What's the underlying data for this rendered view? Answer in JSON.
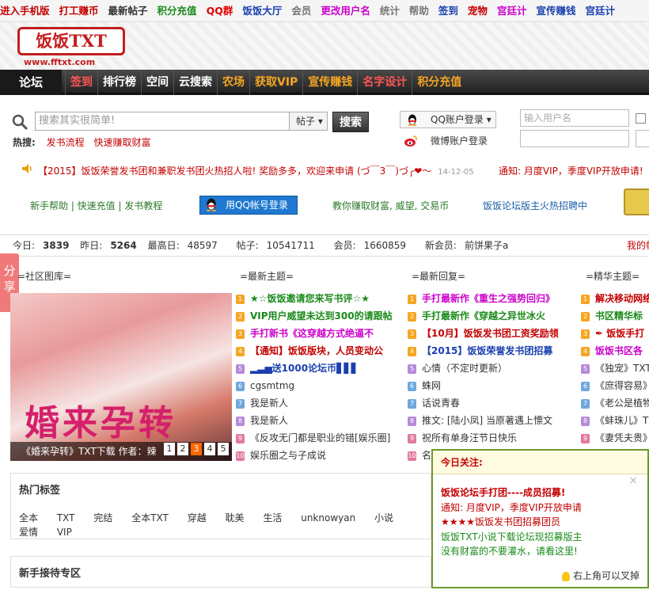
{
  "topbar": [
    {
      "label": "进入手机版",
      "color": "#c40000"
    },
    {
      "label": "打工赚币",
      "color": "#c40000"
    },
    {
      "label": "最新帖子",
      "color": "#333333"
    },
    {
      "label": "积分充值",
      "color": "#1a8a1a"
    },
    {
      "label": "QQ群",
      "color": "#e00000"
    },
    {
      "label": "饭饭大厅",
      "color": "#1a3fb0"
    },
    {
      "label": "会员",
      "color": "#777777"
    },
    {
      "label": "更改用户名",
      "color": "#cc00cc"
    },
    {
      "label": "统计",
      "color": "#777777"
    },
    {
      "label": "帮助",
      "color": "#777777"
    },
    {
      "label": "签到",
      "color": "#1a3fb0"
    },
    {
      "label": "宠物",
      "color": "#c40000"
    },
    {
      "label": "宫廷计",
      "color": "#cc00cc"
    },
    {
      "label": "宣传赚钱",
      "color": "#1a3fb0"
    },
    {
      "label": "宫廷计",
      "color": "#1a3fb0"
    }
  ],
  "logo": {
    "text": "饭饭TXT",
    "url": "www.fftxt.com"
  },
  "nav": {
    "home": "论坛",
    "items": [
      {
        "label": "签到",
        "color": "#ff5555"
      },
      {
        "label": "排行榜",
        "color": "#ffffff"
      },
      {
        "label": "空间",
        "color": "#ffffff"
      },
      {
        "label": "云搜索",
        "color": "#ffffff"
      },
      {
        "label": "农场",
        "color": "#f5a623"
      },
      {
        "label": "获取VIP",
        "color": "#f5a623"
      },
      {
        "label": "宣传赚钱",
        "color": "#f5a623"
      },
      {
        "label": "名字设计",
        "color": "#ff5555"
      },
      {
        "label": "积分充值",
        "color": "#f5a623"
      }
    ]
  },
  "search": {
    "placeholder": "搜索其实很简单!",
    "type": "帖子",
    "button": "搜索"
  },
  "hot": {
    "label": "热搜:",
    "links": [
      "发书流程",
      "快速赚取财富"
    ]
  },
  "login": {
    "qq": "QQ账户登录",
    "weibo": "微博账户登录",
    "username_placeholder": "输入用户名"
  },
  "notice": {
    "text1": "【2015】饭饭荣誉发书团和兼职发书团火热招人啦! 奖励多多，欢迎来申请 (づ￣3￣)づ╭❤～",
    "date": "14-12-05",
    "text2": "通知: 月度VIP，季度VIP开放申请!"
  },
  "quick": {
    "links": "新手帮助 | 快速充值 | 发书教程",
    "qq_button": "用QQ帐号登录",
    "earn": "教你赚取财富, 威望, 交易币",
    "recruit": "饭饭论坛版主火热招聘中"
  },
  "stats": {
    "today_label": "今日:",
    "today": "3839",
    "yesterday_label": "昨日:",
    "yesterday": "5264",
    "max_label": "最高日:",
    "max": "48597",
    "posts_label": "帖子:",
    "posts": "10541711",
    "members_label": "会员:",
    "members": "1660859",
    "newmember_label": "新会员:",
    "newmember": "前饼果子a",
    "right": "我的帖"
  },
  "share": "分享",
  "columns": {
    "gallery": "=社区图库=",
    "latest_topics": "=最新主题=",
    "latest_replies": "=最新回复=",
    "elite_topics": "=精华主题="
  },
  "featured": {
    "title": "婚来孕转",
    "caption": "《婚来孕转》TXT下载  作者：辣",
    "pages": [
      "1",
      "2",
      "3",
      "4",
      "5"
    ],
    "active_page": "3"
  },
  "latest_topics": [
    {
      "n": "1",
      "text": "★☆饭饭邀请您来写书评☆★",
      "color": "#1a8a1a",
      "bold": true
    },
    {
      "n": "2",
      "text": "VIP用户威望未达到300的请跟帖",
      "color": "#1a8a1a",
      "bold": true
    },
    {
      "n": "3",
      "text": "手打新书《这穿越方式绝逼不",
      "color": "#cc00cc",
      "bold": true
    },
    {
      "n": "4",
      "text": "【通知】饭饭版块，人员变动公",
      "color": "#c40000",
      "bold": true
    },
    {
      "n": "5",
      "text": "▂▃▅送1000论坛币▋▋▋",
      "color": "#1a3fb0",
      "bold": true
    },
    {
      "n": "6",
      "text": "cgsmtmg",
      "color": "#333333",
      "bold": false
    },
    {
      "n": "7",
      "text": "我是新人",
      "color": "#333333",
      "bold": false
    },
    {
      "n": "8",
      "text": "我是新人",
      "color": "#333333",
      "bold": false
    },
    {
      "n": "9",
      "text": "《反攻无门都是职业的错[娱乐圈]",
      "color": "#333333",
      "bold": false
    },
    {
      "n": "10",
      "text": "娱乐圈之与子成说",
      "color": "#333333",
      "bold": false
    }
  ],
  "latest_replies": [
    {
      "n": "1",
      "text": "手打最新作《重生之强势回归》",
      "color": "#cc00cc",
      "bold": true
    },
    {
      "n": "2",
      "text": "手打最新作《穿越之异世冰火",
      "color": "#1a8a1a",
      "bold": true
    },
    {
      "n": "3",
      "text": "【10月】饭饭发书团工资奖励领",
      "color": "#c40000",
      "bold": true
    },
    {
      "n": "4",
      "text": "【2015】饭饭荣誉发书团招募",
      "color": "#1a3fb0",
      "bold": true
    },
    {
      "n": "5",
      "text": "心情（不定时更新）",
      "color": "#333333",
      "bold": false
    },
    {
      "n": "6",
      "text": "蛛网",
      "color": "#333333",
      "bold": false
    },
    {
      "n": "7",
      "text": "话说青春",
      "color": "#333333",
      "bold": false
    },
    {
      "n": "8",
      "text": "推文: [陆小凤] 当原著遇上慓文",
      "color": "#333333",
      "bold": false
    },
    {
      "n": "9",
      "text": "祝所有单身汪节日快乐",
      "color": "#333333",
      "bold": false
    },
    {
      "n": "10",
      "text": "名",
      "color": "#333333",
      "bold": false
    }
  ],
  "elite_topics": [
    {
      "n": "1",
      "text": "解决移动网络",
      "color": "#c40000",
      "bold": true
    },
    {
      "n": "2",
      "text": "书区精华标",
      "color": "#1a8a1a",
      "bold": true
    },
    {
      "n": "3",
      "text": "✒ 饭饭手打",
      "color": "#c40000",
      "bold": true
    },
    {
      "n": "4",
      "text": "饭饭书区各",
      "color": "#cc00cc",
      "bold": true
    },
    {
      "n": "5",
      "text": "《独宠》TXT",
      "color": "#333333",
      "bold": false
    },
    {
      "n": "6",
      "text": "《庶得容易》",
      "color": "#333333",
      "bold": false
    },
    {
      "n": "7",
      "text": "《老公是植物",
      "color": "#333333",
      "bold": false
    },
    {
      "n": "8",
      "text": "《蚌珠儿》T",
      "color": "#333333",
      "bold": false
    },
    {
      "n": "9",
      "text": "《妻凭夫贵》",
      "color": "#333333",
      "bold": false
    }
  ],
  "hot_tags": {
    "title": "热门标签",
    "tags": [
      "全本",
      "TXT",
      "完结",
      "全本TXT",
      "穿越",
      "耽美",
      "生活",
      "unknowyan",
      "小说",
      "爱情",
      "VIP"
    ]
  },
  "newbie": {
    "title": "新手接待专区"
  },
  "popup": {
    "title": "今日关注:",
    "close": "×",
    "lines": [
      {
        "text": "饭饭论坛手打团----成员招募!",
        "color": "#c40000",
        "bold": true
      },
      {
        "text": "通知: 月度VIP，季度VIP开放申请",
        "color": "#c40000",
        "bold": false
      },
      {
        "text": "★★★★饭饭发书团招募团员",
        "color": "#c40000",
        "bold": false
      },
      {
        "text": "饭饭TXT小说下载论坛现招募版主",
        "color": "#1a8a1a",
        "bold": false
      },
      {
        "text": "没有财富的不要灌水，请看这里!",
        "color": "#1a8a1a",
        "bold": false
      }
    ],
    "footer": "右上角可以叉掉"
  },
  "number_colors": [
    "#f5a623",
    "#f5a623",
    "#f5a623",
    "#f5a623",
    "#b58ad8",
    "#6fa8dc",
    "#6fa8dc",
    "#b58ad8",
    "#e07aa0",
    "#e07aa0"
  ]
}
